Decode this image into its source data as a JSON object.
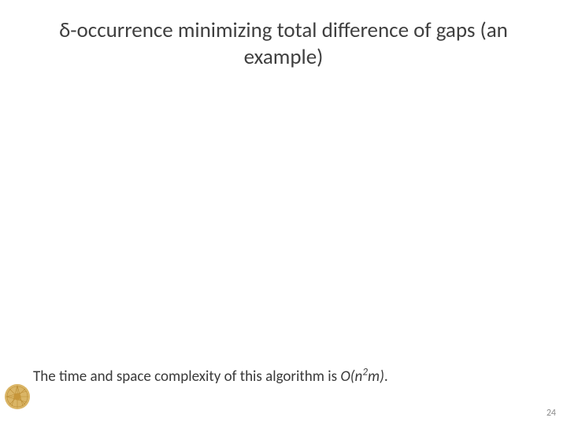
{
  "title": "δ-occurrence minimizing total difference of gaps (an example)",
  "body": {
    "prefix": "The time and space complexity of this algorithm is ",
    "bigO_open": "O(n",
    "bigO_exp": "2",
    "bigO_close": "m)",
    "suffix": "."
  },
  "page_number": "24"
}
